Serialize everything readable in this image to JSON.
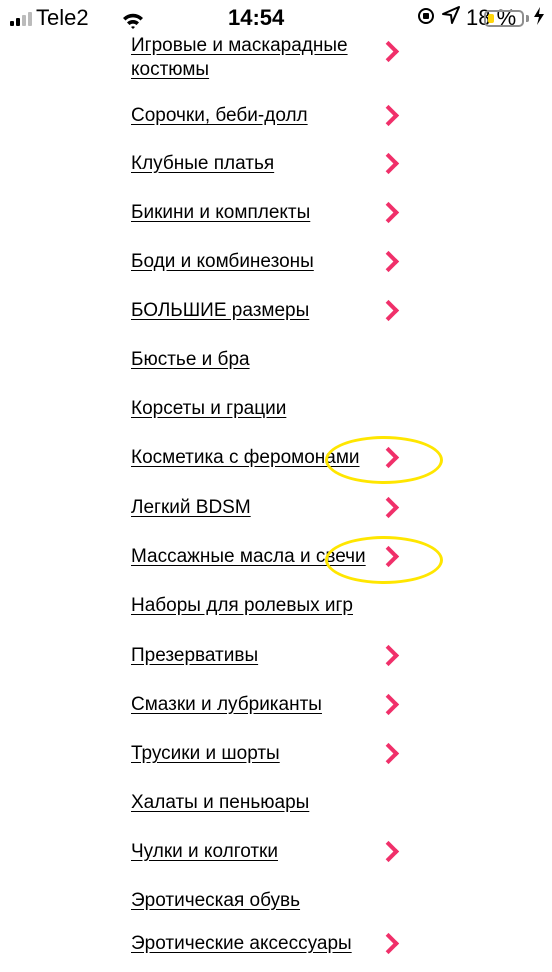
{
  "status_bar": {
    "carrier": "Tele2",
    "time": "14:54",
    "battery_percent": "18 %",
    "battery_level": 0.18,
    "battery_color": "#ffd60a",
    "icons": [
      "signal-icon",
      "wifi-icon",
      "rotation-lock-icon",
      "location-icon",
      "battery-icon",
      "charging-icon"
    ]
  },
  "accent_color": "#f0306a",
  "highlight_color": "#ffe600",
  "menu": {
    "items": [
      {
        "label": "Игровые и маскарадные костюмы",
        "has_arrow": true
      },
      {
        "label": "Сорочки, беби-долл",
        "has_arrow": true
      },
      {
        "label": "Клубные платья",
        "has_arrow": true
      },
      {
        "label": "Бикини и комплекты",
        "has_arrow": true
      },
      {
        "label": "Боди и комбинезоны",
        "has_arrow": true
      },
      {
        "label": "БОЛЬШИЕ размеры",
        "has_arrow": true
      },
      {
        "label": "Бюстье и бра",
        "has_arrow": false
      },
      {
        "label": "Корсеты и грации",
        "has_arrow": false
      },
      {
        "label": "Косметика с феромонами",
        "has_arrow": true
      },
      {
        "label": "Легкий BDSM",
        "has_arrow": true
      },
      {
        "label": "Массажные масла и свечи",
        "has_arrow": true
      },
      {
        "label": "Наборы для ролевых игр",
        "has_arrow": false
      },
      {
        "label": "Презервативы",
        "has_arrow": true
      },
      {
        "label": "Смазки и лубриканты",
        "has_arrow": true
      },
      {
        "label": "Трусики и шорты",
        "has_arrow": true
      },
      {
        "label": "Халаты и пеньюары",
        "has_arrow": false
      },
      {
        "label": "Чулки и колготки",
        "has_arrow": true
      },
      {
        "label": "Эротическая обувь",
        "has_arrow": false
      },
      {
        "label": "Эротические аксессуары",
        "has_arrow": true
      }
    ]
  }
}
